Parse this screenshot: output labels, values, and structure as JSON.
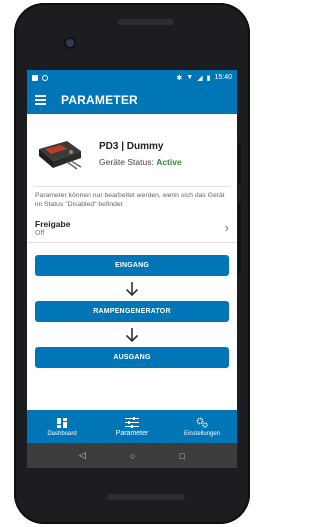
{
  "statusbar": {
    "time": "15:40"
  },
  "appbar": {
    "title": "PARAMETER",
    "menu_icon": "hamburger-menu-icon"
  },
  "device": {
    "name": "PD3 | Dummy",
    "status_label": "Geräte Status:",
    "status_value": "Active",
    "status_color": "#2e8b2e"
  },
  "note": "Parameter können nur bearbeitet werden, wenn sich das Gerät im Status \"Disabled\" befindet",
  "setting": {
    "label": "Freigabe",
    "value": "Off"
  },
  "flow": {
    "step1": "EINGANG",
    "step2": "RAMPENGENERATOR",
    "step3": "AUSGANG"
  },
  "bottomnav": {
    "dashboard": "Dashboard",
    "parameter": "Parameter",
    "einstellungen": "Einstellungen"
  },
  "colors": {
    "primary": "#0176b6",
    "system_nav": "#3b3c3e"
  }
}
